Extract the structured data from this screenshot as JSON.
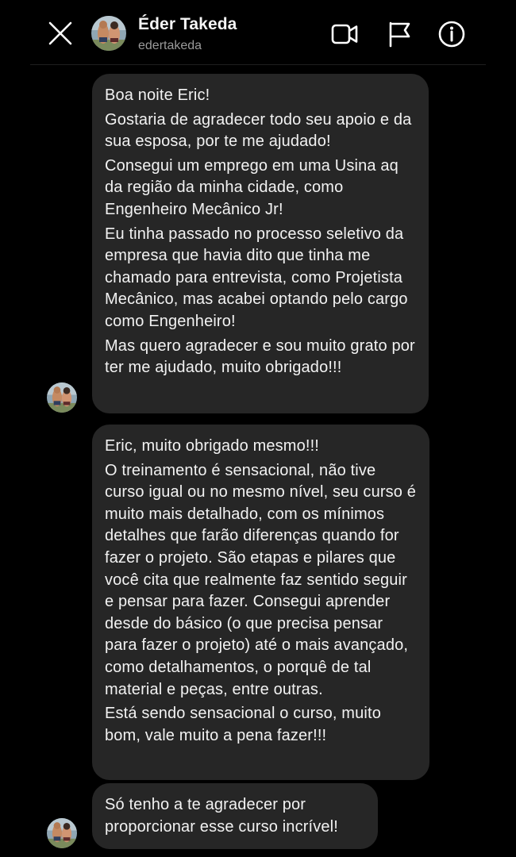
{
  "header": {
    "contact_name": "Éder Takeda",
    "contact_handle": "edertakeda",
    "icons": [
      "close-icon",
      "video-camera-icon",
      "flag-icon",
      "info-icon"
    ]
  },
  "messages": [
    {
      "paragraphs": [
        "Boa noite Eric!",
        "Gostaria de agradecer todo seu apoio e da sua esposa, por te me ajudado!",
        "Consegui um emprego em uma Usina aq da região da minha cidade, como Engenheiro Mecânico Jr!",
        "Eu tinha passado no processo seletivo da empresa que havia dito que tinha me chamado para entrevista, como Projetista Mecânico, mas acabei optando pelo cargo como Engenheiro!",
        "Mas quero agradecer e sou muito grato por ter me ajudado, muito obrigado!!!"
      ]
    },
    {
      "paragraphs": [
        "Eric, muito obrigado mesmo!!!",
        "O treinamento é sensacional, não tive curso igual ou no mesmo nível, seu curso é muito mais detalhado, com os mínimos detalhes que farão diferenças quando for fazer o projeto. São etapas e pilares que você cita que realmente faz sentido seguir e pensar para fazer. Consegui aprender desde do básico (o que precisa pensar para fazer o projeto) até o mais avançado, como detalhamentos, o porquê de tal material e peças, entre outras.",
        "Está sendo sensacional o curso, muito bom, vale muito a pena fazer!!!"
      ]
    },
    {
      "paragraphs": [
        "Só tenho a te agradecer por proporcionar esse curso incrível!"
      ]
    }
  ],
  "colors": {
    "background": "#000000",
    "bubble": "#262626",
    "text": "#f2f2f2",
    "secondary_text": "#9a9a9a"
  }
}
